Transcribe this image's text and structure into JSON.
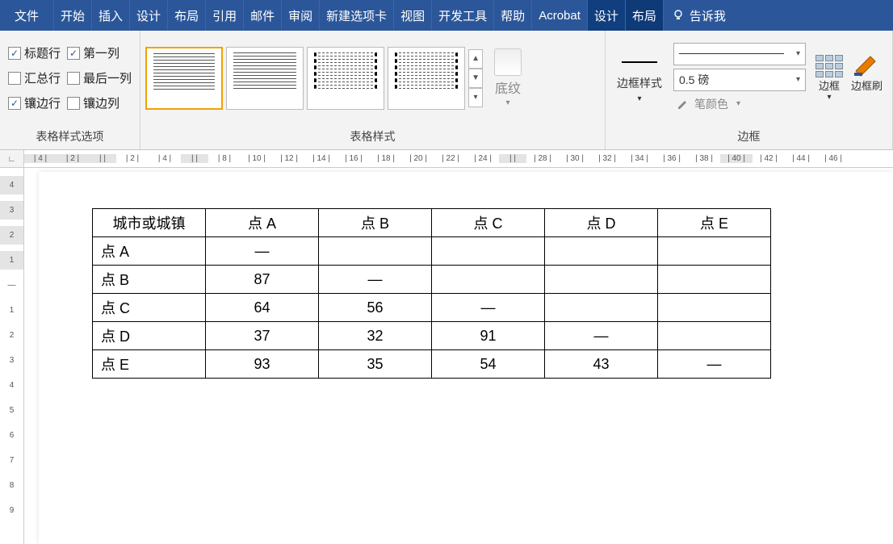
{
  "tabs": {
    "file": "文件",
    "home": "开始",
    "insert": "插入",
    "design": "设计",
    "layout": "布局",
    "references": "引用",
    "mailings": "邮件",
    "review": "审阅",
    "newtab": "新建选项卡",
    "view": "视图",
    "developer": "开发工具",
    "help": "帮助",
    "acrobat": "Acrobat",
    "table_design": "设计",
    "table_layout": "布局",
    "tell_me": "告诉我"
  },
  "style_options": {
    "header_row": "标题行",
    "total_row": "汇总行",
    "banded_rows": "镶边行",
    "first_col": "第一列",
    "last_col": "最后一列",
    "banded_cols": "镶边列",
    "group_label": "表格样式选项"
  },
  "table_styles": {
    "group_label": "表格样式",
    "shading": "底纹"
  },
  "borders": {
    "border_styles": "边框样式",
    "weight": "0.5 磅",
    "pen_color": "笔颜色",
    "borders_btn": "边框",
    "border_painter": "边框刷",
    "group_label": "边框"
  },
  "ruler_marks": [
    "4",
    "2",
    "",
    "2",
    "4",
    "",
    "8",
    "10",
    "12",
    "14",
    "16",
    "18",
    "20",
    "22",
    "24",
    "",
    "28",
    "30",
    "32",
    "34",
    "36",
    "38",
    "40",
    "42",
    "44",
    "46"
  ],
  "ruler_v": [
    "4",
    "3",
    "2",
    "1",
    "",
    "1",
    "2",
    "3",
    "4",
    "5",
    "6",
    "7",
    "8",
    "9"
  ],
  "chart_data": {
    "type": "table",
    "title": "",
    "corner_label": "城市或城镇",
    "columns": [
      "点 A",
      "点 B",
      "点 C",
      "点 D",
      "点 E"
    ],
    "rows": [
      "点 A",
      "点 B",
      "点 C",
      "点 D",
      "点 E"
    ],
    "values": [
      [
        "—",
        "",
        "",
        "",
        ""
      ],
      [
        "87",
        "—",
        "",
        "",
        ""
      ],
      [
        "64",
        "56",
        "—",
        "",
        ""
      ],
      [
        "37",
        "32",
        "91",
        "—",
        ""
      ],
      [
        "93",
        "35",
        "54",
        "43",
        "—"
      ]
    ]
  }
}
